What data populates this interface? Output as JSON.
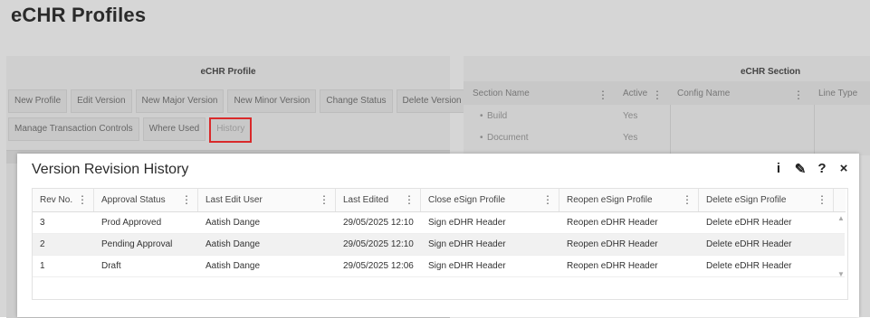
{
  "page": {
    "title": "eCHR Profiles"
  },
  "left_panel": {
    "title": "eCHR Profile",
    "toolbar_row1": [
      "New Profile",
      "Edit Version",
      "New Major Version",
      "New Minor Version",
      "Change Status",
      "Delete Version"
    ],
    "toolbar_row2": [
      "Manage Transaction Controls",
      "Where Used",
      "History"
    ]
  },
  "right_panel": {
    "title": "eCHR Section",
    "columns": [
      "Section Name",
      "Active",
      "Config Name",
      "Line Type"
    ],
    "rows": [
      {
        "section": "Build",
        "active": "Yes"
      },
      {
        "section": "Document",
        "active": "Yes"
      }
    ]
  },
  "modal": {
    "title": "Version Revision History",
    "tools": {
      "info": "i",
      "edit": "✎",
      "help": "?",
      "close": "×"
    },
    "columns": [
      "Rev No.",
      "Approval Status",
      "Last Edit User",
      "Last Edited",
      "Close eSign Profile",
      "Reopen eSign Profile",
      "Delete eSign Profile"
    ],
    "rows": [
      [
        "3",
        "Prod Approved",
        "Aatish Dange",
        "29/05/2025 12:10",
        "Sign eDHR Header",
        "Reopen eDHR Header",
        "Delete eDHR Header"
      ],
      [
        "2",
        "Pending Approval",
        "Aatish Dange",
        "29/05/2025 12:10",
        "Sign eDHR Header",
        "Reopen eDHR Header",
        "Delete eDHR Header"
      ],
      [
        "1",
        "Draft",
        "Aatish Dange",
        "29/05/2025 12:06",
        "Sign eDHR Header",
        "Reopen eDHR Header",
        "Delete eDHR Header"
      ]
    ]
  },
  "colors": {
    "highlight": "#d9292a",
    "overlay": "#d6d6d6"
  }
}
